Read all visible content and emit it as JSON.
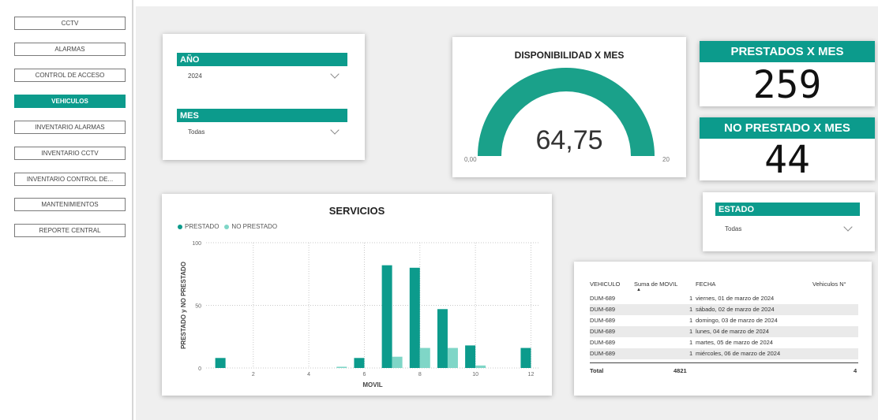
{
  "sidebar": {
    "items": [
      {
        "label": "CCTV",
        "active": false
      },
      {
        "label": "ALARMAS",
        "active": false
      },
      {
        "label": "CONTROL DE ACCESO",
        "active": false
      },
      {
        "label": "VEHICULOS",
        "active": true
      },
      {
        "label": "INVENTARIO ALARMAS",
        "active": false
      },
      {
        "label": "INVENTARIO CCTV",
        "active": false
      },
      {
        "label": "INVENTARIO CONTROL DE...",
        "active": false
      },
      {
        "label": "MANTENIMIENTOS",
        "active": false
      },
      {
        "label": "REPORTE CENTRAL",
        "active": false
      }
    ]
  },
  "filters": {
    "ano": {
      "label": "AÑO",
      "value": "2024"
    },
    "mes": {
      "label": "MES",
      "value": "Todas"
    },
    "estado": {
      "label": "ESTADO",
      "value": "Todas"
    }
  },
  "gauge": {
    "title": "DISPONIBILIDAD X MES",
    "value": "64,75",
    "min": "0,00",
    "max": "20",
    "fill_fraction": 1.0
  },
  "kpis": {
    "prestados": {
      "title": "PRESTADOS X MES",
      "value": "259"
    },
    "no_prestado": {
      "title": "NO PRESTADO X MES",
      "value": "44"
    }
  },
  "chart_data": {
    "type": "bar",
    "title": "SERVICIOS",
    "xlabel": "MOVIL",
    "ylabel": "PRESTADO y NO PRESTADO",
    "ylim": [
      0,
      100
    ],
    "xlim": [
      0.3,
      12.3
    ],
    "x_ticks": [
      2,
      4,
      6,
      8,
      10,
      12
    ],
    "y_ticks": [
      0,
      50,
      100
    ],
    "grid": true,
    "legend_position": "top-left",
    "x": [
      1,
      5,
      6,
      7,
      8,
      9,
      10,
      12
    ],
    "series": [
      {
        "name": "PRESTADO",
        "color": "#0c9b8c",
        "values": [
          8,
          0,
          8,
          82,
          80,
          47,
          18,
          16
        ]
      },
      {
        "name": "NO PRESTADO",
        "color": "#7fd6c7",
        "values": [
          0,
          1,
          0,
          9,
          16,
          16,
          2,
          0
        ]
      }
    ]
  },
  "table": {
    "headers": {
      "vehiculo": "VEHICULO",
      "suma": "Suma de MOVIL",
      "fecha": "FECHA",
      "vn": "Vehiculos N°"
    },
    "rows": [
      {
        "vehiculo": "DUM-689",
        "suma": "1",
        "fecha": "viernes, 01 de marzo de 2024"
      },
      {
        "vehiculo": "DUM-689",
        "suma": "1",
        "fecha": "sábado, 02 de marzo de 2024"
      },
      {
        "vehiculo": "DUM-689",
        "suma": "1",
        "fecha": "domingo, 03 de marzo de 2024"
      },
      {
        "vehiculo": "DUM-689",
        "suma": "1",
        "fecha": "lunes, 04 de marzo de 2024"
      },
      {
        "vehiculo": "DUM-689",
        "suma": "1",
        "fecha": "martes, 05 de marzo de 2024"
      },
      {
        "vehiculo": "DUM-689",
        "suma": "1",
        "fecha": "miércoles, 06 de marzo de 2024"
      }
    ],
    "total": {
      "label": "Total",
      "suma": "4821",
      "vn": "4"
    }
  },
  "colors": {
    "accent": "#0c9b8c",
    "accent_light": "#7fd6c7",
    "canvas": "#efefef"
  }
}
